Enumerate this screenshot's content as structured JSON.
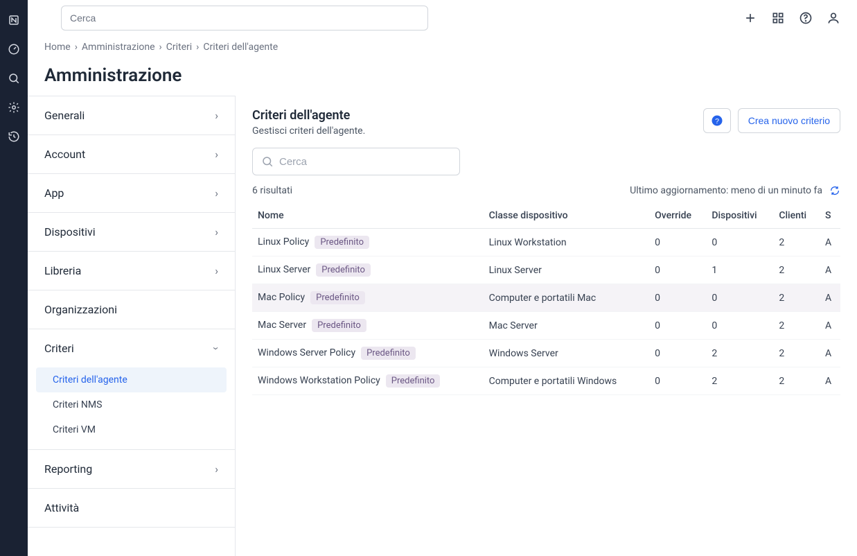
{
  "search": {
    "placeholder": "Cerca"
  },
  "breadcrumbs": {
    "home": "Home",
    "admin": "Amministrazione",
    "criteria": "Criteri",
    "current": "Criteri dell'agente",
    "sep": "›"
  },
  "page_title": "Amministrazione",
  "sidebar_nav": {
    "generali": "Generali",
    "account": "Account",
    "app": "App",
    "dispositivi": "Dispositivi",
    "libreria": "Libreria",
    "organizzazioni": "Organizzazioni",
    "criteri": "Criteri",
    "criteri_sub": {
      "agente": "Criteri dell'agente",
      "nms": "Criteri NMS",
      "vm": "Criteri VM"
    },
    "reporting": "Reporting",
    "attivita": "Attività"
  },
  "section": {
    "title": "Criteri dell'agente",
    "subtitle": "Gestisci criteri dell'agente.",
    "help_tooltip": "?",
    "create_button": "Crea nuovo criterio",
    "filter_placeholder": "Cerca",
    "results_count": "6 risultati",
    "last_updated": "Ultimo aggiornamento: meno di un minuto fa"
  },
  "table": {
    "headers": {
      "name": "Nome",
      "device_class": "Classe dispositivo",
      "override": "Override",
      "devices": "Dispositivi",
      "clients": "Clienti",
      "status": "S"
    },
    "default_badge": "Predefinito",
    "rows": [
      {
        "name": "Linux Policy",
        "default": true,
        "device_class": "Linux Workstation",
        "override": "0",
        "devices": "0",
        "clients": "2",
        "status": "A",
        "selected": false
      },
      {
        "name": "Linux Server",
        "default": true,
        "device_class": "Linux Server",
        "override": "0",
        "devices": "1",
        "clients": "2",
        "status": "A",
        "selected": false
      },
      {
        "name": "Mac Policy",
        "default": true,
        "device_class": "Computer e portatili Mac",
        "override": "0",
        "devices": "0",
        "clients": "2",
        "status": "A",
        "selected": true
      },
      {
        "name": "Mac Server",
        "default": true,
        "device_class": "Mac Server",
        "override": "0",
        "devices": "0",
        "clients": "2",
        "status": "A",
        "selected": false
      },
      {
        "name": "Windows Server Policy",
        "default": true,
        "device_class": "Windows Server",
        "override": "0",
        "devices": "2",
        "clients": "2",
        "status": "A",
        "selected": false
      },
      {
        "name": "Windows Workstation Policy",
        "default": true,
        "device_class": "Computer e portatili Windows",
        "override": "0",
        "devices": "2",
        "clients": "2",
        "status": "A",
        "selected": false
      }
    ]
  }
}
